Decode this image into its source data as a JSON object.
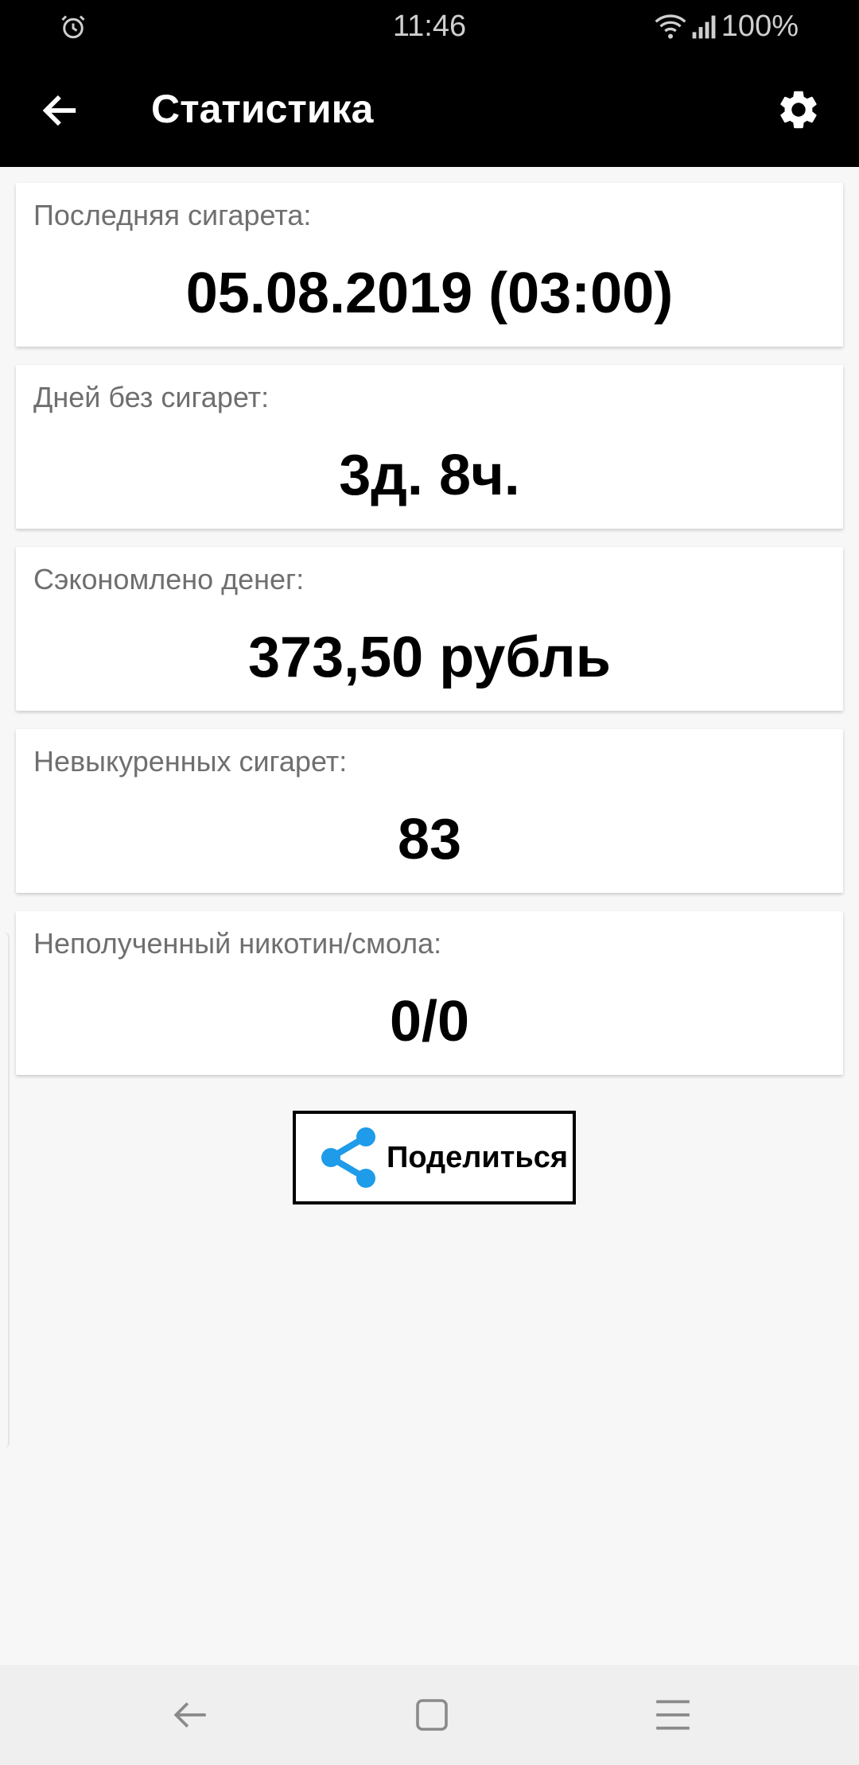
{
  "status_bar": {
    "time": "11:46",
    "battery": "100%",
    "icons": [
      "alarm-icon",
      "wifi-icon",
      "signal-icon"
    ]
  },
  "app_bar": {
    "title": "Статистика",
    "back_icon": "arrow-back-icon",
    "settings_icon": "gear-icon"
  },
  "cards": [
    {
      "label": "Последняя сигарета:",
      "value": "05.08.2019 (03:00)"
    },
    {
      "label": "Дней без сигарет:",
      "value": "3д. 8ч."
    },
    {
      "label": "Сэкономлено денег:",
      "value": "373,50 рубль"
    },
    {
      "label": "Невыкуренных сигарет:",
      "value": "83"
    },
    {
      "label": "Неполученный никотин/смола:",
      "value": "0/0"
    }
  ],
  "share": {
    "label": "Поделиться",
    "icon": "share-icon",
    "icon_color": "#1e9be9"
  },
  "nav_bar": {
    "icons": [
      "nav-back-icon",
      "nav-home-icon",
      "nav-recents-icon"
    ]
  }
}
